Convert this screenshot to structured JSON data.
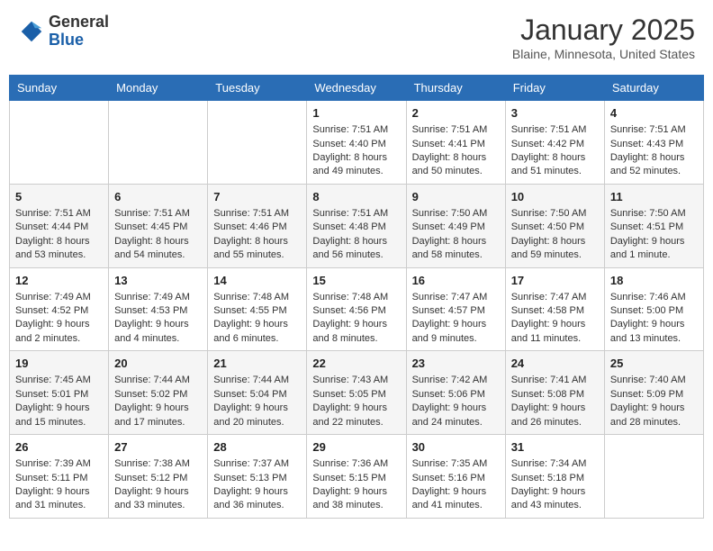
{
  "header": {
    "logo_general": "General",
    "logo_blue": "Blue",
    "month_title": "January 2025",
    "location": "Blaine, Minnesota, United States"
  },
  "days_of_week": [
    "Sunday",
    "Monday",
    "Tuesday",
    "Wednesday",
    "Thursday",
    "Friday",
    "Saturday"
  ],
  "weeks": [
    {
      "days": [
        {
          "num": "",
          "sunrise": "",
          "sunset": "",
          "daylight": "",
          "empty": true
        },
        {
          "num": "",
          "sunrise": "",
          "sunset": "",
          "daylight": "",
          "empty": true
        },
        {
          "num": "",
          "sunrise": "",
          "sunset": "",
          "daylight": "",
          "empty": true
        },
        {
          "num": "1",
          "sunrise": "Sunrise: 7:51 AM",
          "sunset": "Sunset: 4:40 PM",
          "daylight": "Daylight: 8 hours and 49 minutes.",
          "empty": false
        },
        {
          "num": "2",
          "sunrise": "Sunrise: 7:51 AM",
          "sunset": "Sunset: 4:41 PM",
          "daylight": "Daylight: 8 hours and 50 minutes.",
          "empty": false
        },
        {
          "num": "3",
          "sunrise": "Sunrise: 7:51 AM",
          "sunset": "Sunset: 4:42 PM",
          "daylight": "Daylight: 8 hours and 51 minutes.",
          "empty": false
        },
        {
          "num": "4",
          "sunrise": "Sunrise: 7:51 AM",
          "sunset": "Sunset: 4:43 PM",
          "daylight": "Daylight: 8 hours and 52 minutes.",
          "empty": false
        }
      ]
    },
    {
      "days": [
        {
          "num": "5",
          "sunrise": "Sunrise: 7:51 AM",
          "sunset": "Sunset: 4:44 PM",
          "daylight": "Daylight: 8 hours and 53 minutes.",
          "empty": false
        },
        {
          "num": "6",
          "sunrise": "Sunrise: 7:51 AM",
          "sunset": "Sunset: 4:45 PM",
          "daylight": "Daylight: 8 hours and 54 minutes.",
          "empty": false
        },
        {
          "num": "7",
          "sunrise": "Sunrise: 7:51 AM",
          "sunset": "Sunset: 4:46 PM",
          "daylight": "Daylight: 8 hours and 55 minutes.",
          "empty": false
        },
        {
          "num": "8",
          "sunrise": "Sunrise: 7:51 AM",
          "sunset": "Sunset: 4:48 PM",
          "daylight": "Daylight: 8 hours and 56 minutes.",
          "empty": false
        },
        {
          "num": "9",
          "sunrise": "Sunrise: 7:50 AM",
          "sunset": "Sunset: 4:49 PM",
          "daylight": "Daylight: 8 hours and 58 minutes.",
          "empty": false
        },
        {
          "num": "10",
          "sunrise": "Sunrise: 7:50 AM",
          "sunset": "Sunset: 4:50 PM",
          "daylight": "Daylight: 8 hours and 59 minutes.",
          "empty": false
        },
        {
          "num": "11",
          "sunrise": "Sunrise: 7:50 AM",
          "sunset": "Sunset: 4:51 PM",
          "daylight": "Daylight: 9 hours and 1 minute.",
          "empty": false
        }
      ]
    },
    {
      "days": [
        {
          "num": "12",
          "sunrise": "Sunrise: 7:49 AM",
          "sunset": "Sunset: 4:52 PM",
          "daylight": "Daylight: 9 hours and 2 minutes.",
          "empty": false
        },
        {
          "num": "13",
          "sunrise": "Sunrise: 7:49 AM",
          "sunset": "Sunset: 4:53 PM",
          "daylight": "Daylight: 9 hours and 4 minutes.",
          "empty": false
        },
        {
          "num": "14",
          "sunrise": "Sunrise: 7:48 AM",
          "sunset": "Sunset: 4:55 PM",
          "daylight": "Daylight: 9 hours and 6 minutes.",
          "empty": false
        },
        {
          "num": "15",
          "sunrise": "Sunrise: 7:48 AM",
          "sunset": "Sunset: 4:56 PM",
          "daylight": "Daylight: 9 hours and 8 minutes.",
          "empty": false
        },
        {
          "num": "16",
          "sunrise": "Sunrise: 7:47 AM",
          "sunset": "Sunset: 4:57 PM",
          "daylight": "Daylight: 9 hours and 9 minutes.",
          "empty": false
        },
        {
          "num": "17",
          "sunrise": "Sunrise: 7:47 AM",
          "sunset": "Sunset: 4:58 PM",
          "daylight": "Daylight: 9 hours and 11 minutes.",
          "empty": false
        },
        {
          "num": "18",
          "sunrise": "Sunrise: 7:46 AM",
          "sunset": "Sunset: 5:00 PM",
          "daylight": "Daylight: 9 hours and 13 minutes.",
          "empty": false
        }
      ]
    },
    {
      "days": [
        {
          "num": "19",
          "sunrise": "Sunrise: 7:45 AM",
          "sunset": "Sunset: 5:01 PM",
          "daylight": "Daylight: 9 hours and 15 minutes.",
          "empty": false
        },
        {
          "num": "20",
          "sunrise": "Sunrise: 7:44 AM",
          "sunset": "Sunset: 5:02 PM",
          "daylight": "Daylight: 9 hours and 17 minutes.",
          "empty": false
        },
        {
          "num": "21",
          "sunrise": "Sunrise: 7:44 AM",
          "sunset": "Sunset: 5:04 PM",
          "daylight": "Daylight: 9 hours and 20 minutes.",
          "empty": false
        },
        {
          "num": "22",
          "sunrise": "Sunrise: 7:43 AM",
          "sunset": "Sunset: 5:05 PM",
          "daylight": "Daylight: 9 hours and 22 minutes.",
          "empty": false
        },
        {
          "num": "23",
          "sunrise": "Sunrise: 7:42 AM",
          "sunset": "Sunset: 5:06 PM",
          "daylight": "Daylight: 9 hours and 24 minutes.",
          "empty": false
        },
        {
          "num": "24",
          "sunrise": "Sunrise: 7:41 AM",
          "sunset": "Sunset: 5:08 PM",
          "daylight": "Daylight: 9 hours and 26 minutes.",
          "empty": false
        },
        {
          "num": "25",
          "sunrise": "Sunrise: 7:40 AM",
          "sunset": "Sunset: 5:09 PM",
          "daylight": "Daylight: 9 hours and 28 minutes.",
          "empty": false
        }
      ]
    },
    {
      "days": [
        {
          "num": "26",
          "sunrise": "Sunrise: 7:39 AM",
          "sunset": "Sunset: 5:11 PM",
          "daylight": "Daylight: 9 hours and 31 minutes.",
          "empty": false
        },
        {
          "num": "27",
          "sunrise": "Sunrise: 7:38 AM",
          "sunset": "Sunset: 5:12 PM",
          "daylight": "Daylight: 9 hours and 33 minutes.",
          "empty": false
        },
        {
          "num": "28",
          "sunrise": "Sunrise: 7:37 AM",
          "sunset": "Sunset: 5:13 PM",
          "daylight": "Daylight: 9 hours and 36 minutes.",
          "empty": false
        },
        {
          "num": "29",
          "sunrise": "Sunrise: 7:36 AM",
          "sunset": "Sunset: 5:15 PM",
          "daylight": "Daylight: 9 hours and 38 minutes.",
          "empty": false
        },
        {
          "num": "30",
          "sunrise": "Sunrise: 7:35 AM",
          "sunset": "Sunset: 5:16 PM",
          "daylight": "Daylight: 9 hours and 41 minutes.",
          "empty": false
        },
        {
          "num": "31",
          "sunrise": "Sunrise: 7:34 AM",
          "sunset": "Sunset: 5:18 PM",
          "daylight": "Daylight: 9 hours and 43 minutes.",
          "empty": false
        },
        {
          "num": "",
          "sunrise": "",
          "sunset": "",
          "daylight": "",
          "empty": true
        }
      ]
    }
  ]
}
